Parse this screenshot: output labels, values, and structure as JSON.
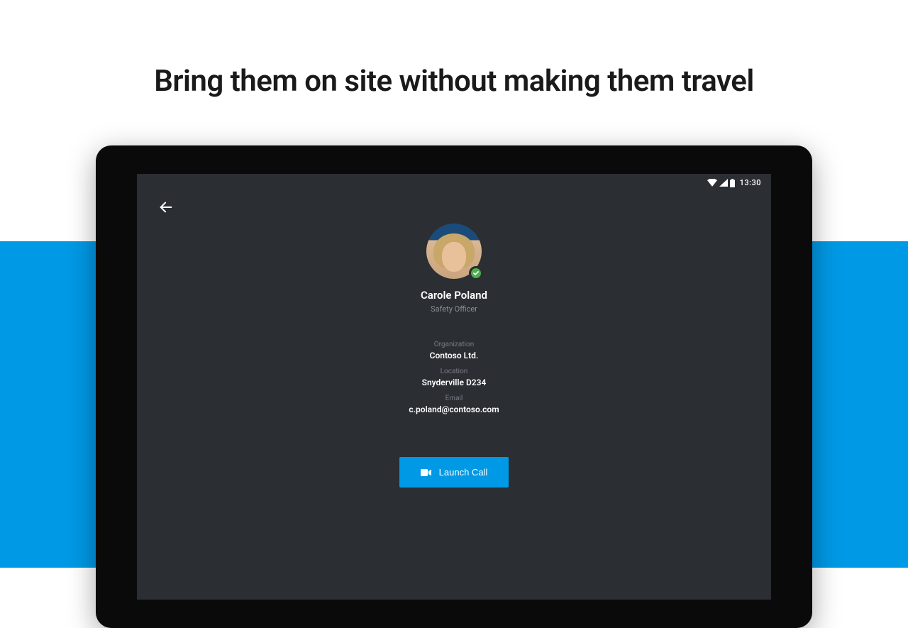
{
  "headline": "Bring them on site without making them travel",
  "status": {
    "time": "13:30"
  },
  "contact": {
    "name": "Carole Poland",
    "role": "Safety Officer",
    "presence": "available",
    "fields": {
      "org_label": "Organization",
      "org_value": "Contoso Ltd.",
      "location_label": "Location",
      "location_value": "Snyderville D234",
      "email_label": "Email",
      "email_value": "c.poland@contoso.com"
    }
  },
  "actions": {
    "launch_call_label": "Launch Call"
  },
  "colors": {
    "accent": "#0099e5",
    "screen_bg": "#2b2e33",
    "presence_available": "#4caf50"
  }
}
